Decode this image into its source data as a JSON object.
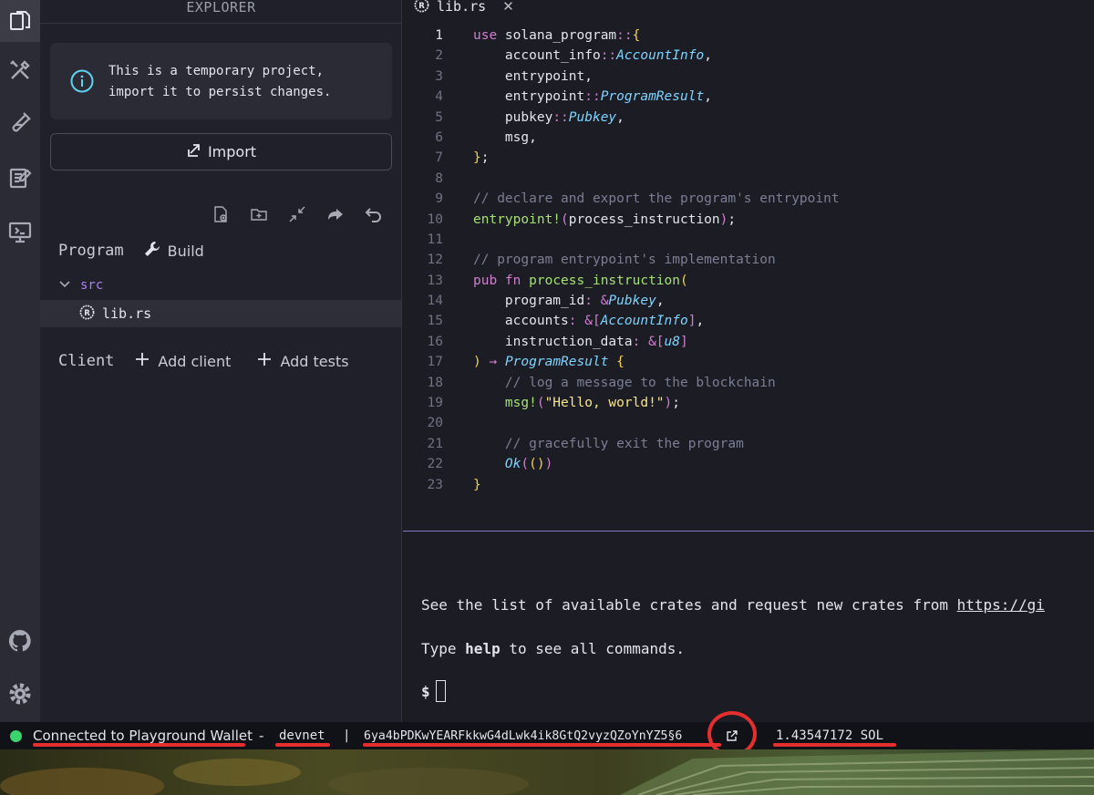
{
  "sidebar": {
    "title": "EXPLORER",
    "notice": "This is a temporary project,\nimport it to persist changes.",
    "import_label": "Import",
    "program_label": "Program",
    "build_label": "Build",
    "folder_name": "src",
    "file_name": "lib.rs",
    "client_label": "Client",
    "add_client_label": "Add client",
    "add_tests_label": "Add tests"
  },
  "editor": {
    "tab_label": "lib.rs",
    "close_glyph": "✕",
    "line_numbers": [
      "1",
      "2",
      "3",
      "4",
      "5",
      "6",
      "7",
      "8",
      "9",
      "10",
      "11",
      "12",
      "13",
      "14",
      "15",
      "16",
      "17",
      "18",
      "19",
      "20",
      "21",
      "22",
      "23"
    ],
    "current_line": 1
  },
  "terminal": {
    "crates_text": "See the list of available crates and request new crates from ",
    "crates_link": "https://gi",
    "help_prefix": "Type ",
    "help_word": "help",
    "help_suffix": " to see all commands.",
    "prompt": "$"
  },
  "statusbar": {
    "connection": "Connected to Playground Wallet",
    "sep1": "-",
    "network": "devnet",
    "sep2": "|",
    "address": "6ya4bPDKwYEARFkkwG4dLwk4ik8GtQ2vyzQZoYnYZ5§6",
    "balance": "1.43547172 SOL"
  },
  "colors": {
    "accent": "#8a74c4",
    "status_connected": "#3ad56d",
    "annotation": "#e52e2e"
  },
  "icons": [
    "explorer-icon",
    "tools-icon",
    "test-icon",
    "tutorials-icon",
    "programs-icon",
    "github-icon",
    "settings-icon",
    "info-icon",
    "import-icon",
    "new-file-icon",
    "new-folder-icon",
    "collapse-icon",
    "share-icon",
    "undo-icon",
    "wrench-icon",
    "chevron-down-icon",
    "rust-icon",
    "plus-icon",
    "external-link-icon"
  ]
}
